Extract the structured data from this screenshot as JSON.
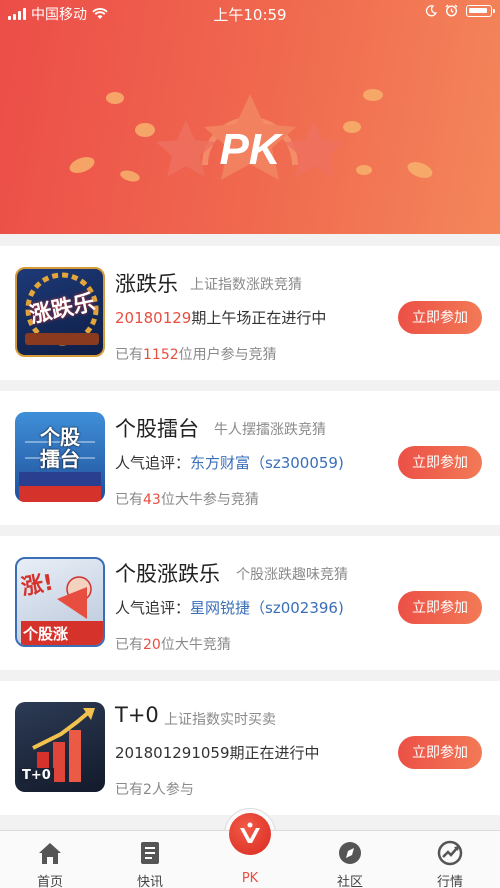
{
  "status_bar": {
    "carrier": "中国移动",
    "time": "上午10:59"
  },
  "header": {
    "emblem_text": "PK"
  },
  "colors": {
    "accent": "#e84e40",
    "link": "#3a6fb8"
  },
  "cards": [
    {
      "title": "涨跌乐",
      "subtitle": "上证指数涨跌竞猜",
      "line2_highlight": "20180129",
      "line2_rest": "期上午场正在进行中",
      "line3_prefix": "已有",
      "line3_count": "1152",
      "line3_suffix": "位用户参与竞猜",
      "button": "立即参加",
      "thumb_text": "涨跌乐"
    },
    {
      "title": "个股擂台",
      "subtitle": "牛人摆擂涨跌竞猜",
      "line2_label": "人气追评：",
      "line2_stock": "东方财富（sz300059)",
      "line3_prefix": "已有",
      "line3_count": "43",
      "line3_suffix": "位大牛参与竞猜",
      "button": "立即参加",
      "thumb_text": "个股擂台"
    },
    {
      "title": "个股涨跌乐",
      "subtitle": "个股涨跌趣味竞猜",
      "line2_label": "人气追评：",
      "line2_stock": "星网锐捷（sz002396)",
      "line3_prefix": "已有",
      "line3_count": "20",
      "line3_suffix": "位大牛竞猜",
      "button": "立即参加",
      "thumb_text_1": "涨!",
      "thumb_text_2": "个股涨"
    },
    {
      "title": "T+0",
      "subtitle": "上证指数实时买卖",
      "line2_text": "201801291059期正在进行中",
      "line3_text": "已有2人参与",
      "button": "立即参加",
      "thumb_text": "T+0"
    }
  ],
  "tabbar": {
    "tabs": [
      {
        "label": "首页",
        "icon": "home-icon"
      },
      {
        "label": "快讯",
        "icon": "news-icon"
      },
      {
        "label": "PK",
        "icon": "pk-icon"
      },
      {
        "label": "社区",
        "icon": "compass-icon"
      },
      {
        "label": "行情",
        "icon": "market-icon"
      }
    ]
  }
}
